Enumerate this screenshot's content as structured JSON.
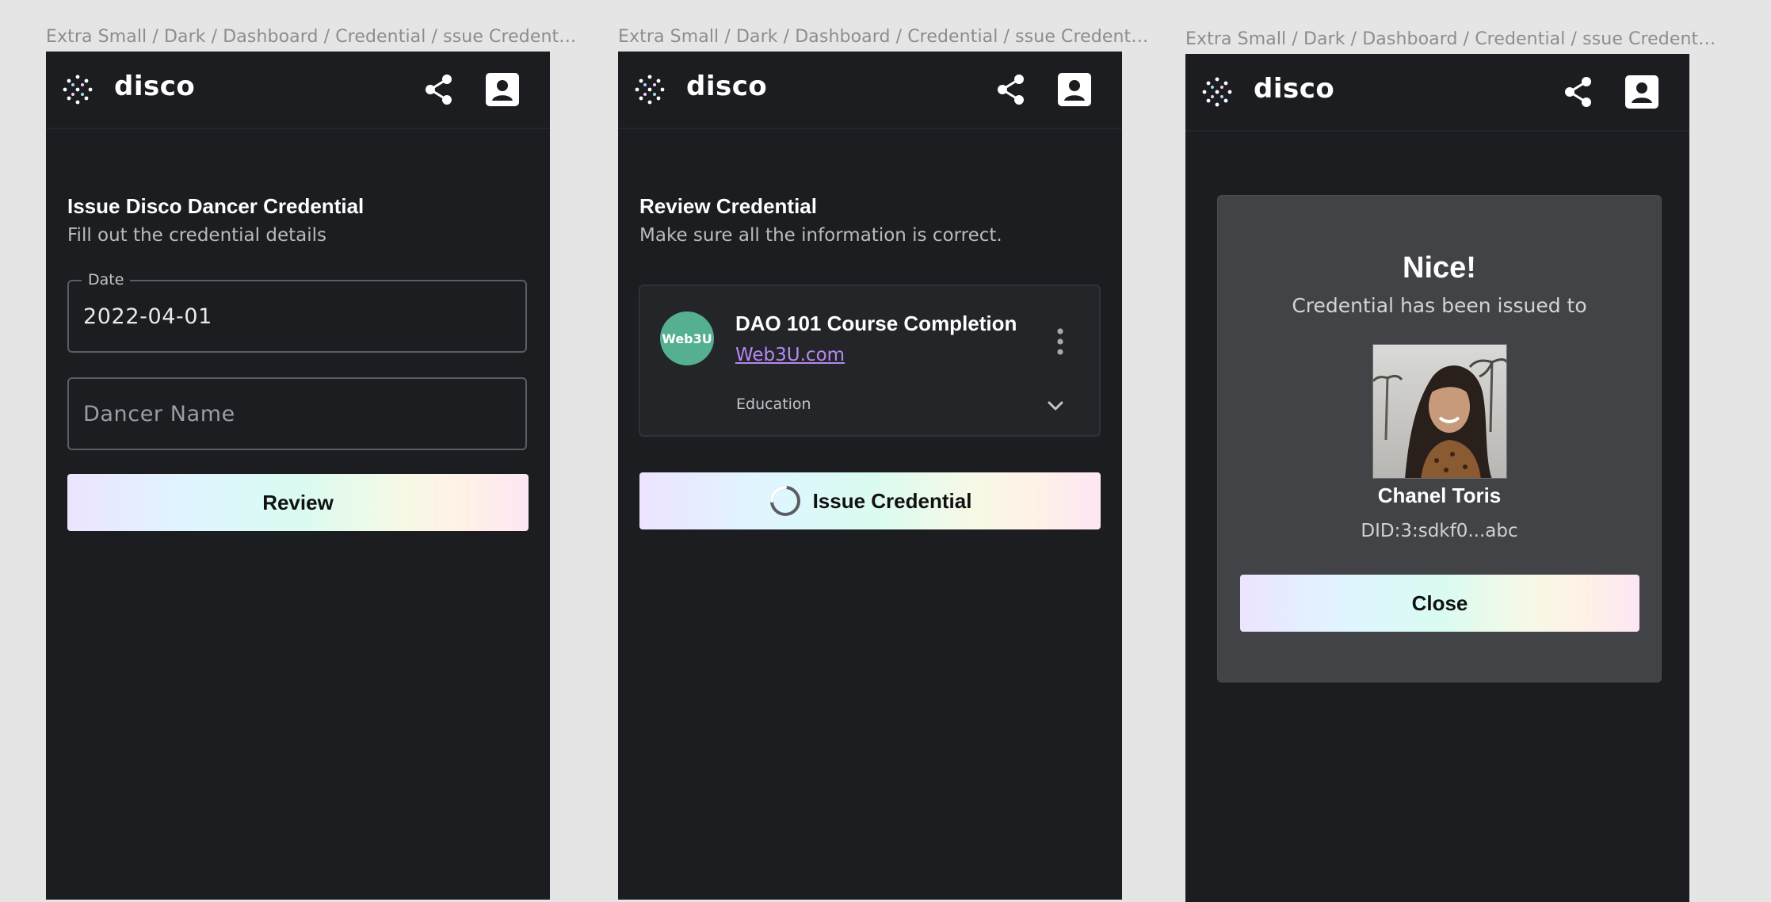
{
  "frames": [
    {
      "label": "Extra Small / Dark / Dashboard / Credential / ssue Credent…"
    },
    {
      "label": "Extra Small / Dark / Dashboard / Credential / ssue Credent…"
    },
    {
      "label": "Extra Small / Dark / Dashboard / Credential / ssue Credent…"
    }
  ],
  "app": {
    "brand": "disco"
  },
  "issue_form": {
    "title": "Issue Disco Dancer Credential",
    "subtitle": "Fill out the credential details",
    "date_label": "Date",
    "date_value": "2022-04-01",
    "dancer_placeholder": "Dancer Name",
    "review_button": "Review"
  },
  "review": {
    "title": "Review Credential",
    "subtitle": "Make sure all the information is correct.",
    "credential": {
      "avatar_text": "Web3U",
      "name": "DAO 101 Course Completion",
      "issuer_link": "Web3U.com",
      "category": "Education"
    },
    "issue_button": "Issue Credential"
  },
  "success": {
    "heading": "Nice!",
    "message": "Credential has been issued to",
    "recipient_name": "Chanel Toris",
    "recipient_did": "DID:3:sdkf0...abc",
    "close_button": "Close"
  },
  "colors": {
    "frame_bg": "#1b1d20",
    "card_bg": "#232529",
    "modal_bg": "#414347",
    "link": "#b589f1",
    "avatar_green": "#55b092"
  }
}
